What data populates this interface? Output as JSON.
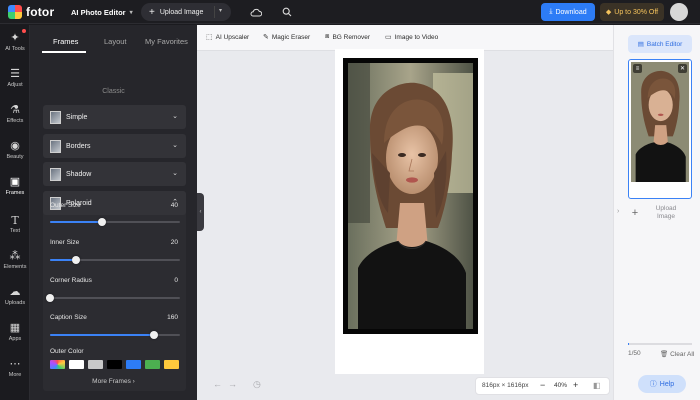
{
  "topbar": {
    "logo_text": "fotor",
    "app_title": "AI Photo Editor",
    "upload_label": "Upload Image",
    "download_label": "Download",
    "promo_label": "Up to 30% Off"
  },
  "rail": {
    "items": [
      {
        "label": "AI Tools",
        "icon": "sparkle-icon"
      },
      {
        "label": "Adjust",
        "icon": "sliders-icon"
      },
      {
        "label": "Effects",
        "icon": "flask-icon"
      },
      {
        "label": "Beauty",
        "icon": "eye-icon"
      },
      {
        "label": "Frames",
        "icon": "frame-icon"
      },
      {
        "label": "Text",
        "icon": "text-icon"
      },
      {
        "label": "Elements",
        "icon": "shapes-icon"
      },
      {
        "label": "Uploads",
        "icon": "cloud-upload-icon"
      },
      {
        "label": "Apps",
        "icon": "apps-icon"
      },
      {
        "label": "More",
        "icon": "more-icon"
      }
    ],
    "active": "Frames"
  },
  "panel": {
    "tabs": [
      "Frames",
      "Layout",
      "My Favorites"
    ],
    "active_tab": "Frames",
    "section_label": "Classic",
    "accordions": [
      "Simple",
      "Borders",
      "Shadow",
      "Polaroid"
    ],
    "sliders": [
      {
        "label": "Outer Size",
        "value": "40",
        "fraction": 0.4
      },
      {
        "label": "Inner Size",
        "value": "20",
        "fraction": 0.2
      },
      {
        "label": "Corner Radius",
        "value": "0",
        "fraction": 0.0
      },
      {
        "label": "Caption Size",
        "value": "160",
        "fraction": 0.8
      }
    ],
    "outer_color_label": "Outer Color",
    "swatches": [
      "#ffffff",
      "#c9c9c9",
      "#000000",
      "#2d7cf6",
      "#4caf50",
      "#ffc93d"
    ],
    "more_frames_label": "More Frames"
  },
  "toolbar": {
    "tools": [
      "AI Upscaler",
      "Magic Eraser",
      "BG Remover",
      "Image to Video"
    ]
  },
  "canvas": {
    "dimensions": "816px × 1616px",
    "zoom": "40%"
  },
  "rpanel": {
    "batch_label": "Batch Editor",
    "upload_label": "Upload Image",
    "count": "1/50",
    "progress": 0.02,
    "clear_label": "Clear All",
    "help_label": "Help"
  }
}
